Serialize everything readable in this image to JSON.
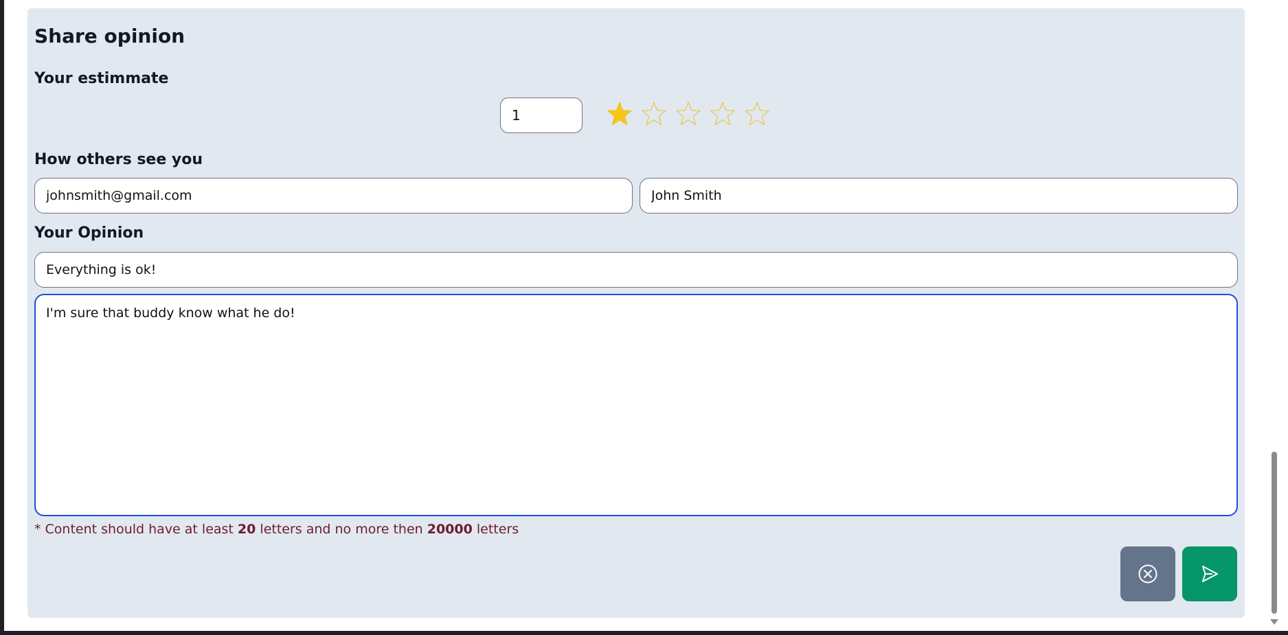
{
  "form": {
    "title": "Share opinion",
    "estimate_label": "Your estimmate",
    "rating_value": "1",
    "rating": 1,
    "rating_max": 5,
    "identity_label": "How others see you",
    "email_value": "johnsmith@gmail.com",
    "name_value": "John Smith",
    "opinion_label": "Your Opinion",
    "opinion_title_value": "Everything is ok!",
    "opinion_body_value": "I'm sure that buddy know what he do!",
    "note_prefix": "* Content should have at least ",
    "note_min": "20",
    "note_middle": " letters and no more then ",
    "note_max": "20000",
    "note_suffix": " letters"
  },
  "colors": {
    "star_filled": "#f5c518",
    "star_outline": "#e8c547",
    "cancel_button": "#64748b",
    "send_button": "#059669",
    "panel_background": "#e2e8f0",
    "textarea_focus_border": "#1d4ed8"
  },
  "icons": {
    "cancel": "circle-x-icon",
    "send": "paper-plane-icon",
    "star": "star-icon"
  }
}
